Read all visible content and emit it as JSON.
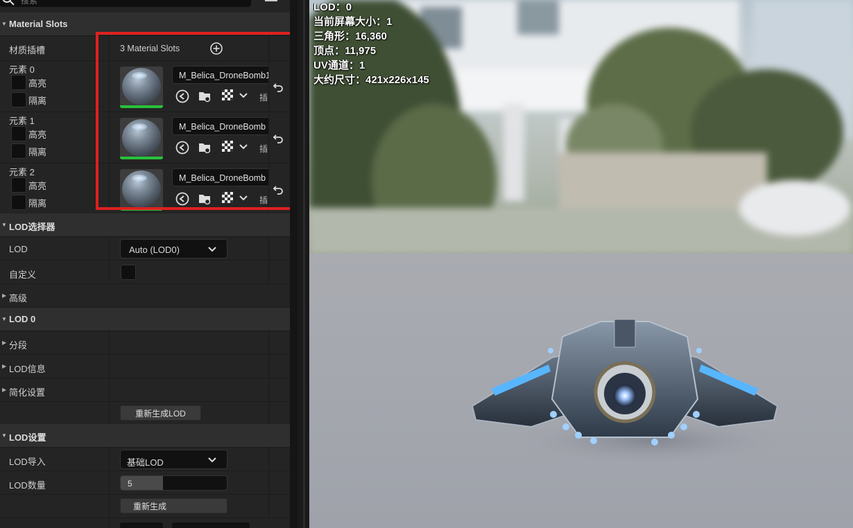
{
  "search": {
    "placeholder": "搜索"
  },
  "material_slots": {
    "category": "Material Slots",
    "slot_label": "材质插槽",
    "slot_count": "3 Material Slots",
    "elements": [
      {
        "title": "元素 0",
        "highlight": "高亮",
        "isolate": "隔离",
        "material": "M_Belica_DroneBomb1",
        "plug": "插"
      },
      {
        "title": "元素 1",
        "highlight": "高亮",
        "isolate": "隔离",
        "material": "M_Belica_DroneBomb",
        "plug": "插"
      },
      {
        "title": "元素 2",
        "highlight": "高亮",
        "isolate": "隔离",
        "material": "M_Belica_DroneBomb",
        "plug": "插"
      }
    ]
  },
  "lod_picker": {
    "category": "LOD选择器",
    "lod_label": "LOD",
    "lod_value": "Auto (LOD0)",
    "custom_label": "自定义",
    "advanced_label": "高级"
  },
  "lod0": {
    "category": "LOD 0",
    "sections_label": "分段",
    "lod_info_label": "LOD信息",
    "reduction_label": "简化设置",
    "regen_button": "重新生成LOD"
  },
  "lod_settings": {
    "category": "LOD设置",
    "import_label": "LOD导入",
    "import_value": "基础LOD",
    "count_label": "LOD数量",
    "count_value": "5",
    "count_fraction": 0.4,
    "regen_button": "重新生成"
  },
  "viewport_stats": [
    "LOD：0",
    "当前屏幕大小：1",
    "三角形：16,360",
    "顶点：11,975",
    "UV通道：1",
    "大约尺寸：421x226x145"
  ],
  "colors": {
    "highlight_box": "#e0201e",
    "panel_bg": "#242424",
    "category_bg": "#2f2f2f",
    "thumb_green": "#27c23a"
  }
}
